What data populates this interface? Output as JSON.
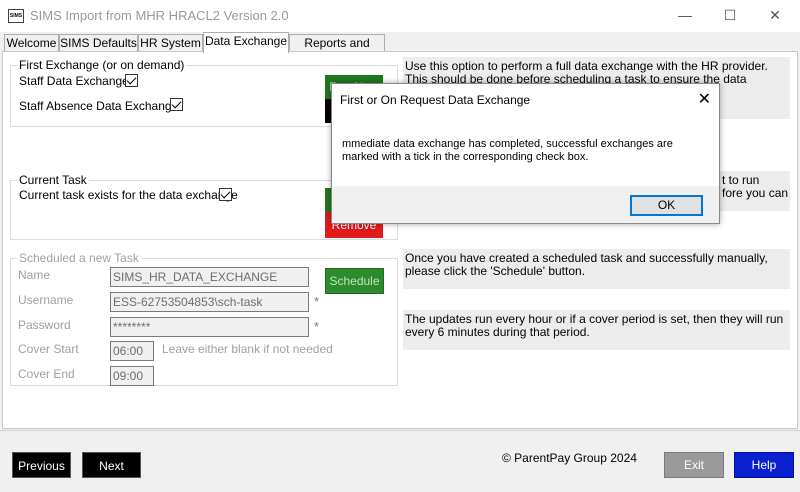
{
  "window": {
    "app_icon_text": "SIMS",
    "title": "SIMS Import from MHR HRACL2 Version 2.0",
    "minimize": "—",
    "maximize": "☐",
    "close": "✕"
  },
  "tabs": [
    {
      "label": "Welcome"
    },
    {
      "label": "SIMS Defaults"
    },
    {
      "label": "HR System"
    },
    {
      "label": "Data Exchange"
    },
    {
      "label": "Reports and Tools"
    }
  ],
  "active_tab": "Data Exchange",
  "first_exchange": {
    "legend": "First Exchange (or on demand)",
    "staff_data_label": "Staff Data Exchange",
    "staff_data_checked": true,
    "staff_absence_label": "Staff Absence Data Exchange",
    "staff_absence_checked": true,
    "run_button_label": "Run Now",
    "info": "Use this option to perform a full data exchange with the HR provider. This should be done before scheduling a task to ensure the data exchange is functioning"
  },
  "current_task": {
    "legend": "Current Task",
    "label": "Current task exists for the data exchange",
    "checked": true,
    "remove_button_label": "Remove",
    "info": "t to run\nfore you can"
  },
  "scheduled_task": {
    "legend": "Scheduled a new Task",
    "name_label": "Name",
    "name_value": "SIMS_HR_DATA_EXCHANGE",
    "username_label": "Username",
    "username_value": "ESS-62753504853\\sch-task",
    "password_label": "Password",
    "password_value": "********",
    "cover_start_label": "Cover Start",
    "cover_start_value": "06:00",
    "cover_end_label": "Cover End",
    "cover_end_value": "09:00",
    "cover_hint": "Leave either blank if not needed",
    "required_marker": "*",
    "schedule_button_label": "Schedule",
    "info_schedule": "Once you have created a scheduled task and successfully  manually, please click the 'Schedule' button.",
    "info_updates": "The updates run every hour or if a cover period is set, then they will run every 6 minutes during that period."
  },
  "footer": {
    "previous_label": "Previous",
    "next_label": "Next",
    "copyright": "© ParentPay Group 2024",
    "exit_label": "Exit",
    "help_label": "Help"
  },
  "dialog": {
    "title": "First or On Request Data Exchange",
    "close": "✕",
    "message": "mmediate data exchange has completed, successful exchanges are marked with a tick in the corresponding check box.",
    "ok_label": "OK"
  },
  "colors": {
    "green_button": "#1e7a1e",
    "red_button": "#e21b1b",
    "help_button": "#0a1fd0",
    "exit_button": "#9a9a9a",
    "focus_border": "#0078d7"
  }
}
